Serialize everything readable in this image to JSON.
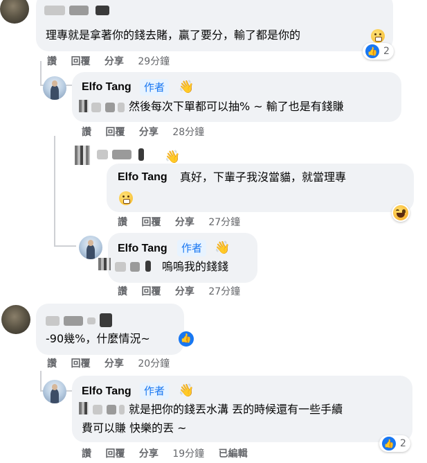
{
  "comments": [
    {
      "text": "理專就是拿著你的錢去賭，贏了要分，輸了都是你的",
      "actions": {
        "like": "讚",
        "reply": "回覆",
        "share": "分享",
        "time": "29分鐘"
      },
      "reaction_count": "2"
    },
    {
      "author": "Elfo Tang",
      "badge": "作者",
      "text": "然後每次下單都可以抽% ~ 輸了也是有錢賺",
      "actions": {
        "like": "讚",
        "reply": "回覆",
        "share": "分享",
        "time": "28分鐘"
      }
    },
    {
      "author": "Elfo Tang",
      "text": "真好，下輩子我沒當貓，就當理專",
      "actions": {
        "like": "讚",
        "reply": "回覆",
        "share": "分享",
        "time": "27分鐘"
      }
    },
    {
      "author": "Elfo Tang",
      "badge": "作者",
      "text": "嗚嗚我的錢錢",
      "actions": {
        "like": "讚",
        "reply": "回覆",
        "share": "分享",
        "time": "27分鐘"
      }
    },
    {
      "text": "-90幾%，什麼情況~",
      "actions": {
        "like": "讚",
        "reply": "回覆",
        "share": "分享",
        "time": "20分鐘"
      }
    },
    {
      "author": "Elfo Tang",
      "badge": "作者",
      "text_line1": "就是把你的錢丟水溝 丟的時候還有一些手續",
      "text_line2": "費可以賺 快樂的丟 ~",
      "actions": {
        "like": "讚",
        "reply": "回覆",
        "share": "分享",
        "time": "19分鐘",
        "edited": "已編輯"
      },
      "reaction_count": "2"
    }
  ],
  "colors": {
    "bubble": "#f0f2f5",
    "badge_bg": "#e7f3ff",
    "badge_text": "#1877f2",
    "meta": "#65676b",
    "like_blue": "#1877f2"
  },
  "icons": [
    "wave-icon",
    "like-icon",
    "haha-icon",
    "grin-emoji-icon"
  ]
}
